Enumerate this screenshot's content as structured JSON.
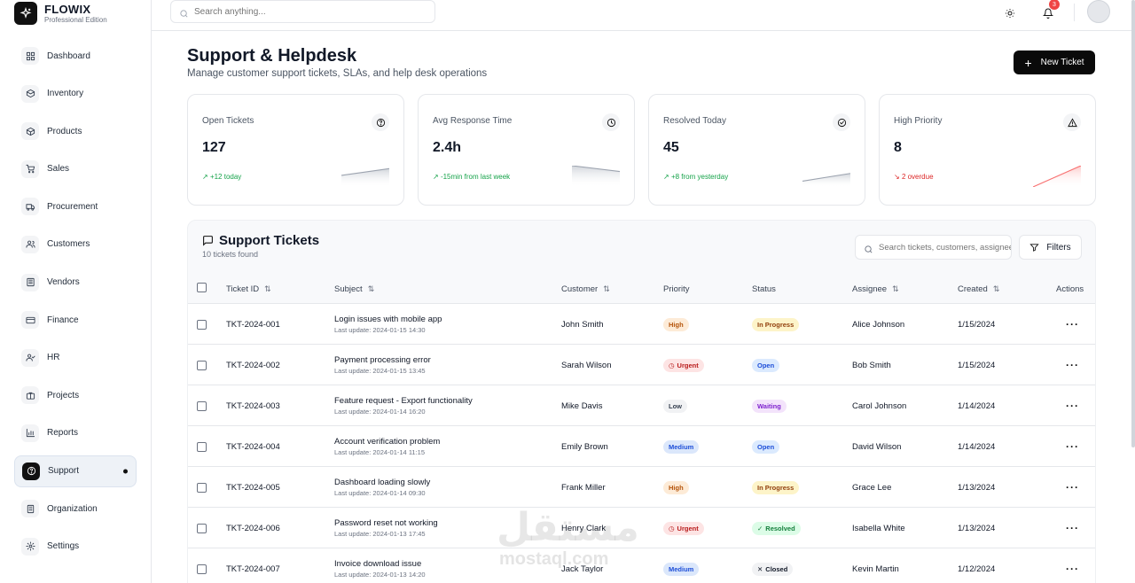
{
  "brand": {
    "name": "FLOWIX",
    "edition": "Professional Edition"
  },
  "sidebar": {
    "items": [
      {
        "label": "Dashboard",
        "icon": "grid-icon"
      },
      {
        "label": "Inventory",
        "icon": "box-icon"
      },
      {
        "label": "Products",
        "icon": "package-icon"
      },
      {
        "label": "Sales",
        "icon": "cart-icon"
      },
      {
        "label": "Procurement",
        "icon": "truck-icon"
      },
      {
        "label": "Customers",
        "icon": "users-icon"
      },
      {
        "label": "Vendors",
        "icon": "building-icon"
      },
      {
        "label": "Finance",
        "icon": "card-icon"
      },
      {
        "label": "HR",
        "icon": "user-check-icon"
      },
      {
        "label": "Projects",
        "icon": "briefcase-icon"
      },
      {
        "label": "Reports",
        "icon": "bar-chart-icon"
      },
      {
        "label": "Support",
        "icon": "help-circle-icon",
        "active": true
      },
      {
        "label": "Organization",
        "icon": "office-icon"
      },
      {
        "label": "Settings",
        "icon": "gear-icon"
      }
    ]
  },
  "topbar": {
    "search_placeholder": "Search anything...",
    "notification_count": "3"
  },
  "page": {
    "title": "Support & Helpdesk",
    "subtitle": "Manage customer support tickets, SLAs, and help desk operations",
    "new_ticket_label": "New Ticket"
  },
  "stats": [
    {
      "label": "Open Tickets",
      "value": "127",
      "trend": "+12 today",
      "trend_color": "#16a34a",
      "icon": "question-icon"
    },
    {
      "label": "Avg Response Time",
      "value": "2.4h",
      "trend": "-15min from last week",
      "trend_color": "#16a34a",
      "icon": "clock-icon"
    },
    {
      "label": "Resolved Today",
      "value": "45",
      "trend": "+8 from yesterday",
      "trend_color": "#16a34a",
      "icon": "check-circle-icon"
    },
    {
      "label": "High Priority",
      "value": "8",
      "trend": "2 overdue",
      "trend_color": "#dc2626",
      "icon": "alert-triangle-icon"
    }
  ],
  "tickets_panel": {
    "title": "Support Tickets",
    "count": "10 tickets found",
    "search_placeholder": "Search tickets, customers, assignees...",
    "filters_label": "Filters",
    "columns": [
      "Ticket ID",
      "Subject",
      "Customer",
      "Priority",
      "Status",
      "Assignee",
      "Created",
      "Actions"
    ],
    "rows": [
      {
        "id": "TKT-2024-001",
        "subject": "Login issues with mobile app",
        "updated": "Last update: 2024-01-15 14:30",
        "customer": "John Smith",
        "priority": "High",
        "status": "In Progress",
        "assignee": "Alice Johnson",
        "created": "1/15/2024"
      },
      {
        "id": "TKT-2024-002",
        "subject": "Payment processing error",
        "updated": "Last update: 2024-01-15 13:45",
        "customer": "Sarah Wilson",
        "priority": "Urgent",
        "status": "Open",
        "assignee": "Bob Smith",
        "created": "1/15/2024"
      },
      {
        "id": "TKT-2024-003",
        "subject": "Feature request - Export functionality",
        "updated": "Last update: 2024-01-14 16:20",
        "customer": "Mike Davis",
        "priority": "Low",
        "status": "Waiting",
        "assignee": "Carol Johnson",
        "created": "1/14/2024"
      },
      {
        "id": "TKT-2024-004",
        "subject": "Account verification problem",
        "updated": "Last update: 2024-01-14 11:15",
        "customer": "Emily Brown",
        "priority": "Medium",
        "status": "Open",
        "assignee": "David Wilson",
        "created": "1/14/2024"
      },
      {
        "id": "TKT-2024-005",
        "subject": "Dashboard loading slowly",
        "updated": "Last update: 2024-01-14 09:30",
        "customer": "Frank Miller",
        "priority": "High",
        "status": "In Progress",
        "assignee": "Grace Lee",
        "created": "1/13/2024"
      },
      {
        "id": "TKT-2024-006",
        "subject": "Password reset not working",
        "updated": "Last update: 2024-01-13 17:45",
        "customer": "Henry Clark",
        "priority": "Urgent",
        "status": "Resolved",
        "assignee": "Isabella White",
        "created": "1/13/2024"
      },
      {
        "id": "TKT-2024-007",
        "subject": "Invoice download issue",
        "updated": "Last update: 2024-01-13 14:20",
        "customer": "Jack Taylor",
        "priority": "Medium",
        "status": "Closed",
        "assignee": "Kevin Martin",
        "created": "1/12/2024"
      }
    ]
  },
  "colors": {
    "priority": {
      "High": [
        "#fdebd7",
        "#b45309"
      ],
      "Urgent": [
        "#fde4e4",
        "#b91c1c"
      ],
      "Low": [
        "#f1f2f4",
        "#374151"
      ],
      "Medium": [
        "#dbe7fb",
        "#1d4ed8"
      ]
    },
    "status": {
      "In Progress": [
        "#fdf4c9",
        "#92400e"
      ],
      "Open": [
        "#dbeafe",
        "#1d4ed8"
      ],
      "Waiting": [
        "#f3e3fb",
        "#7e22ce"
      ],
      "Resolved": [
        "#dcfce7",
        "#15803d"
      ],
      "Closed": [
        "#f1f2f4",
        "#111827"
      ]
    }
  },
  "watermark": {
    "arabic": "مستقل",
    "latin": "mostaql.com"
  }
}
